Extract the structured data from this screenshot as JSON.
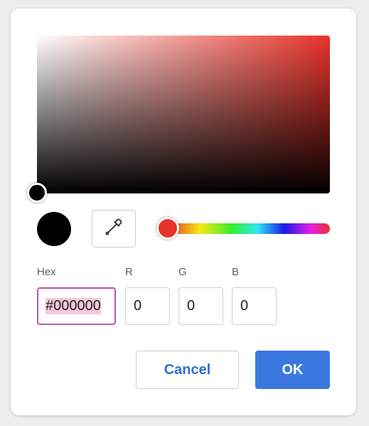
{
  "picker": {
    "current_color": "#000000",
    "hue_color": "#e8332a",
    "saturation": 0,
    "value": 0
  },
  "fields": {
    "hex_label": "Hex",
    "hex_value": "#000000",
    "r_label": "R",
    "r_value": "0",
    "g_label": "G",
    "g_value": "0",
    "b_label": "B",
    "b_value": "0"
  },
  "icons": {
    "eyedropper": "eyedropper-icon"
  },
  "buttons": {
    "cancel": "Cancel",
    "ok": "OK"
  },
  "colors": {
    "accent": "#3a78e0",
    "cancel_text": "#2f6fd6",
    "hex_focus_border": "#b65aa5"
  }
}
